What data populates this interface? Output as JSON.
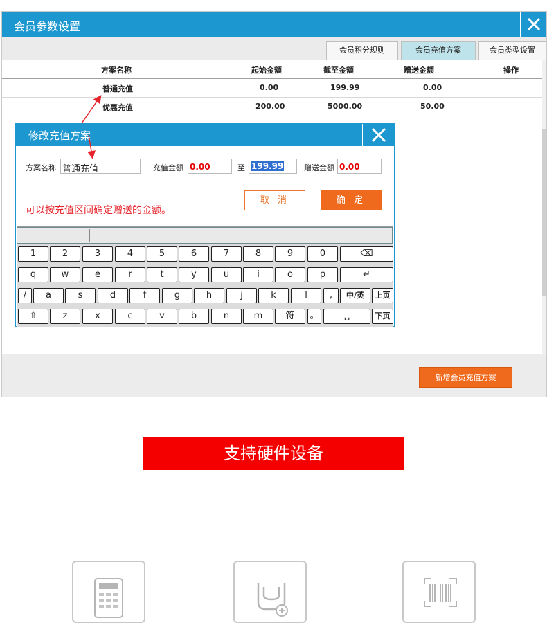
{
  "window": {
    "title": "会员参数设置",
    "tabs": [
      {
        "label": "会员积分规则",
        "active": false
      },
      {
        "label": "会员充值方案",
        "active": true
      },
      {
        "label": "会员类型设置",
        "active": false
      }
    ],
    "table": {
      "headers": [
        "方案名称",
        "起始金额",
        "截至金额",
        "赠送金额",
        "操作"
      ],
      "rows": [
        [
          "普通充值",
          "0.00",
          "199.99",
          "0.00",
          ""
        ],
        [
          "优惠充值",
          "200.00",
          "5000.00",
          "50.00",
          ""
        ]
      ]
    },
    "add_button": "新增会员充值方案"
  },
  "dialog": {
    "title": "修改充值方案",
    "name_label": "方案名称",
    "name_value": "普通充值",
    "amount_label": "充值金额",
    "amount_from": "0.00",
    "to_label": "至",
    "amount_to": "199.99",
    "gift_label": "赠送金额",
    "gift_value": "0.00",
    "cancel": "取 消",
    "ok": "确 定",
    "hint": "可以按充值区间确定赠送的金额。"
  },
  "keyboard": {
    "rows": [
      [
        "1",
        "2",
        "3",
        "4",
        "5",
        "6",
        "7",
        "8",
        "9",
        "0",
        "⌫"
      ],
      [
        "q",
        "w",
        "e",
        "r",
        "t",
        "y",
        "u",
        "i",
        "o",
        "p",
        "↵"
      ],
      [
        "/",
        "a",
        "s",
        "d",
        "f",
        "g",
        "h",
        "j",
        "k",
        "l",
        ",",
        "中/英",
        "上页"
      ],
      [
        "⇧",
        "z",
        "x",
        "c",
        "v",
        "b",
        "n",
        "m",
        "符",
        "。",
        "␣",
        "下页"
      ]
    ]
  },
  "banner": "支持硬件设备",
  "devices": [
    {
      "icon": "calculator-icon"
    },
    {
      "icon": "card-reader-icon"
    },
    {
      "icon": "barcode-scanner-icon"
    }
  ],
  "colors": {
    "titlebar": "#1d97cf",
    "accent_orange": "#ef6a1d",
    "banner_red": "#f50000",
    "hint_red": "#e6242b",
    "active_tab": "#bfe3ea"
  }
}
